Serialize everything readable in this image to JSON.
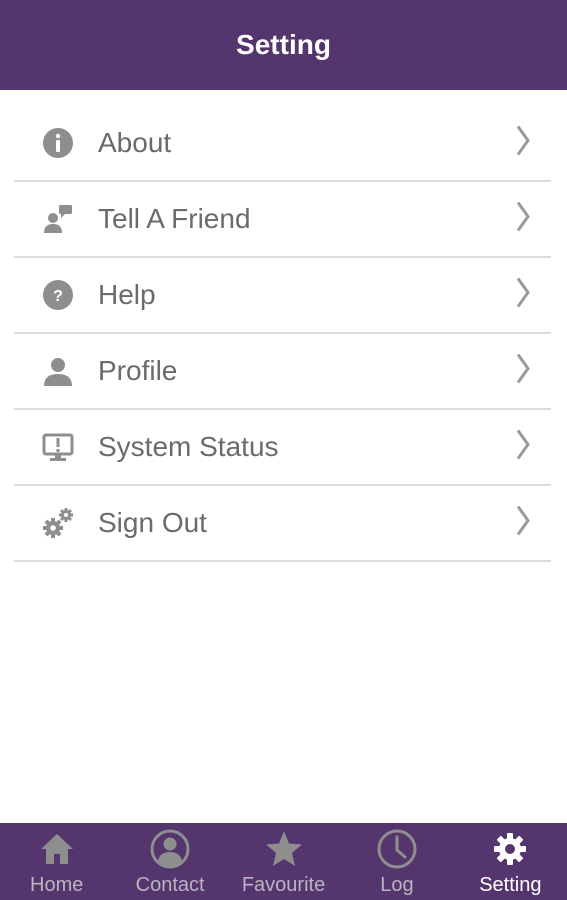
{
  "header": {
    "title": "Setting"
  },
  "menu": {
    "items": [
      {
        "label": "About",
        "icon": "info-icon"
      },
      {
        "label": "Tell A Friend",
        "icon": "tell-friend-icon"
      },
      {
        "label": "Help",
        "icon": "help-icon"
      },
      {
        "label": "Profile",
        "icon": "user-icon"
      },
      {
        "label": "System Status",
        "icon": "monitor-alert-icon"
      },
      {
        "label": "Sign Out",
        "icon": "gears-icon"
      }
    ]
  },
  "tabbar": {
    "tabs": [
      {
        "label": "Home",
        "icon": "home-icon",
        "active": false
      },
      {
        "label": "Contact",
        "icon": "contact-icon",
        "active": false
      },
      {
        "label": "Favourite",
        "icon": "star-icon",
        "active": false
      },
      {
        "label": "Log",
        "icon": "clock-icon",
        "active": false
      },
      {
        "label": "Setting",
        "icon": "gear-icon",
        "active": true
      }
    ]
  },
  "colors": {
    "brand": "#55356e",
    "icon_gray": "#8e8e8e",
    "tab_inactive": "#b9b4c0",
    "tab_active": "#ffffff"
  }
}
